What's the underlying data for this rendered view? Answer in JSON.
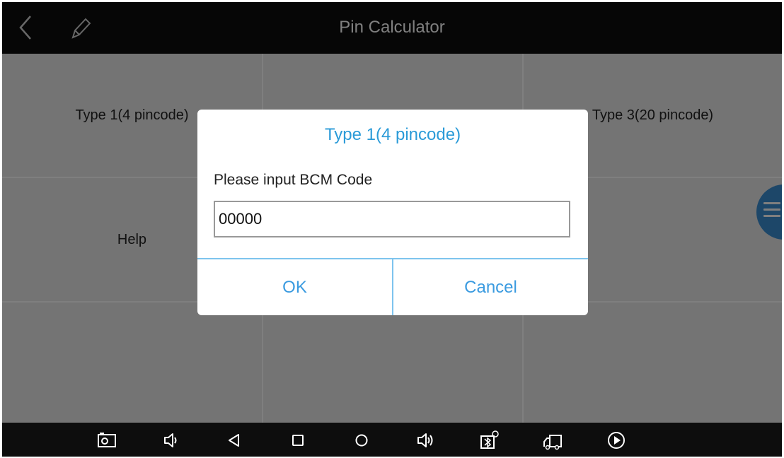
{
  "header": {
    "title": "Pin Calculator"
  },
  "grid": {
    "cells": [
      {
        "label": "Type 1(4 pincode)"
      },
      {
        "label": ""
      },
      {
        "label": "Type 3(20 pincode)"
      },
      {
        "label": "Help"
      },
      {
        "label": ""
      },
      {
        "label": ""
      },
      {
        "label": ""
      },
      {
        "label": ""
      },
      {
        "label": ""
      }
    ]
  },
  "dialog": {
    "title": "Type 1(4 pincode)",
    "prompt": "Please input BCM Code",
    "input_value": "00000",
    "ok_label": "OK",
    "cancel_label": "Cancel"
  },
  "icons": {
    "back": "chevron-left-icon",
    "edit": "pencil-icon",
    "menu": "hamburger-menu-icon",
    "nav": [
      "screenshot-icon",
      "volume-down-icon",
      "back-triangle-icon",
      "recents-square-icon",
      "home-circle-icon",
      "volume-up-icon",
      "bluetooth-vci-icon",
      "truck-icon",
      "play-circle-icon"
    ]
  },
  "colors": {
    "accent": "#2b9bd8",
    "cell_bg": "#e9e9e9",
    "bar_bg": "#0d0d0d",
    "fab": "#3b8fd3"
  }
}
